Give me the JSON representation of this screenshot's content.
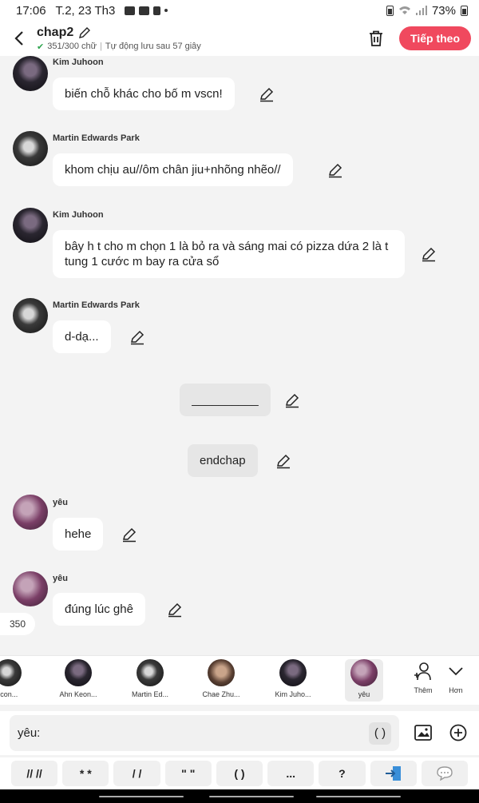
{
  "status_bar": {
    "time": "17:06",
    "date": "T.2, 23 Th3",
    "battery": "73%"
  },
  "header": {
    "title": "chap2",
    "word_count": "351/300 chữ",
    "autosave": "Tự động lưu sau 57 giây",
    "next_label": "Tiếp theo"
  },
  "messages": [
    {
      "sender": "Kim Juhoon",
      "text": "biến chỗ khác cho bố m vscn!"
    },
    {
      "sender": "Martin Edwards Park",
      "text": "khom chịu au//ôm chân jiu+nhõng nhẽo//"
    },
    {
      "sender": "Kim Juhoon",
      "text": "bây h t cho m chọn 1 là bỏ ra và sáng mai có pizza dứa 2 là t tung 1 cước m bay ra cửa sổ"
    },
    {
      "sender": "Martin Edwards Park",
      "text": "d-dạ..."
    },
    {
      "sender": "",
      "text": "__________"
    },
    {
      "sender": "",
      "text": "endchap"
    },
    {
      "sender": "yêu",
      "text": "hehe"
    },
    {
      "sender": "yêu",
      "text": "đúng lúc ghê"
    }
  ],
  "counter": "350",
  "characters": [
    {
      "name": "Icon..."
    },
    {
      "name": "Ahn Keon..."
    },
    {
      "name": "Martin Ed..."
    },
    {
      "name": "Chae Zhu..."
    },
    {
      "name": "Kim Juho..."
    },
    {
      "name": "yêu"
    }
  ],
  "side_buttons": {
    "more_label": "Thêm",
    "less_label": "Hơn"
  },
  "input": {
    "label": "yêu:",
    "paren": "( )"
  },
  "quick_buttons": [
    "// //",
    "* *",
    "/ /",
    "\" \"",
    "( )",
    "...",
    "?"
  ],
  "colors": {
    "accent": "#f0495e",
    "check": "#2da44e"
  }
}
